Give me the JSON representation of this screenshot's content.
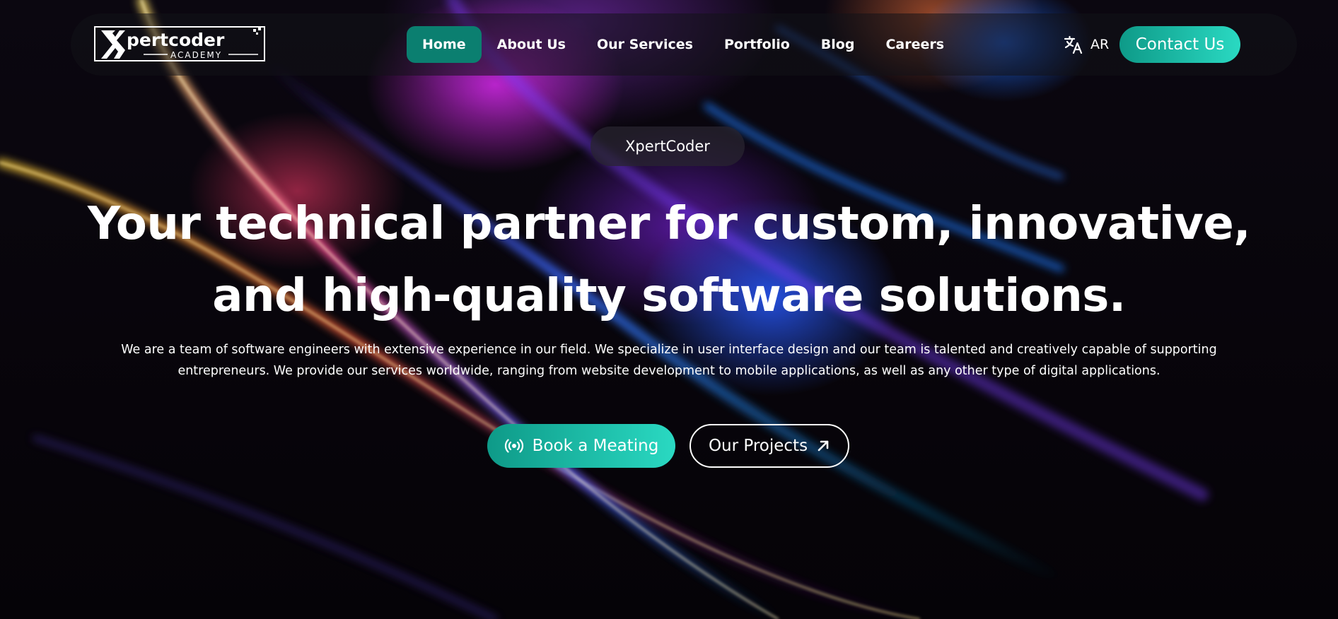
{
  "brand": {
    "logo_text": "Xpertcoder",
    "logo_subtext": "ACADEMY"
  },
  "nav": {
    "items": [
      {
        "label": "Home",
        "active": true
      },
      {
        "label": "About Us",
        "active": false
      },
      {
        "label": "Our Services",
        "active": false
      },
      {
        "label": "Portfolio",
        "active": false
      },
      {
        "label": "Blog",
        "active": false
      },
      {
        "label": "Careers",
        "active": false
      }
    ],
    "language_label": "AR",
    "language_icon": "translate-icon",
    "contact_label": "Contact Us"
  },
  "hero": {
    "badge": "XpertCoder",
    "title": "Your technical partner for custom, innovative, and high-quality software solutions.",
    "description": "We are a team of software engineers with extensive experience in our field. We specialize in user interface design and our team is talented and creatively capable of supporting entrepreneurs. We provide our services worldwide, ranging from website development to mobile applications, as well as any other type of digital applications.",
    "primary_button": {
      "label": "Book a Meating",
      "icon": "broadcast-icon"
    },
    "secondary_button": {
      "label": "Our Projects",
      "icon": "arrow-up-right-icon"
    }
  },
  "colors": {
    "accent": "#0b7f70",
    "accent_light": "#2ad9c2",
    "background": "#07050a",
    "text": "#ffffff"
  }
}
